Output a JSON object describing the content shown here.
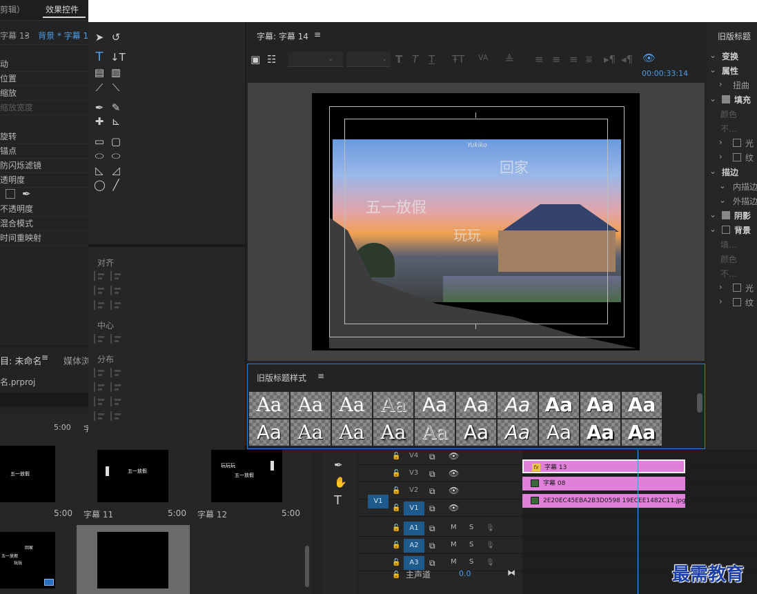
{
  "left_panel": {
    "header_label": "剪辑）",
    "tab_effect_controls": "效果控件",
    "source_label": "字幕 13",
    "clip_label": "背景 * 字幕 1",
    "props": [
      "动",
      "位置",
      "缩放",
      "缩放宽度",
      "",
      "旋转",
      "锚点",
      "防闪烁滤镜",
      "透明度",
      "",
      "不透明度",
      "混合模式",
      "时间重映射"
    ]
  },
  "project_panel": {
    "tab_project": "目: 未命名",
    "tab_media": "媒体浏",
    "file_name": "名.prproj",
    "items": [
      {
        "name": "",
        "duration": "5:00",
        "thumb_text": "五一放假"
      },
      {
        "name": "字幕 11",
        "duration": "5:00",
        "thumb_text": "五一放假"
      },
      {
        "name": "字幕 12",
        "duration": "5:00",
        "thumb_text": "五一放假"
      }
    ],
    "top_durations": [
      "5:00",
      "字"
    ],
    "thumb_texts": [
      "五一放假",
      "回家",
      "玩玩",
      "玩玩玩"
    ]
  },
  "titler": {
    "title": "字幕: 字幕 14",
    "timecode": "00:00:33:14",
    "tools_section_align": "对齐",
    "tools_section_center": "中心",
    "tools_section_distribute": "分布",
    "canvas_texts": {
      "t1": "五一放假",
      "t2": "回家",
      "t3": "玩玩",
      "signature": "Yukiko"
    },
    "styles_panel_title": "旧版标题样式",
    "swatch_label": "Aa",
    "swatch_rows": 2,
    "swatch_cols": 10
  },
  "props_panel": {
    "title": "旧版标题",
    "items": [
      {
        "label": "变换",
        "kind": "section"
      },
      {
        "label": "属性",
        "kind": "section"
      },
      {
        "label": "扭曲",
        "kind": "sub"
      },
      {
        "label": "填充",
        "kind": "check-section"
      },
      {
        "label": "颜色",
        "kind": "dim"
      },
      {
        "label": "不...",
        "kind": "dim"
      },
      {
        "label": "光",
        "kind": "sub-check"
      },
      {
        "label": "纹",
        "kind": "sub-check"
      },
      {
        "label": "描边",
        "kind": "section"
      },
      {
        "label": "内描边",
        "kind": "sub"
      },
      {
        "label": "外描边",
        "kind": "sub"
      },
      {
        "label": "阴影",
        "kind": "check-section"
      },
      {
        "label": "背景",
        "kind": "check-section"
      },
      {
        "label": "填...",
        "kind": "dim"
      },
      {
        "label": "颜色",
        "kind": "dim"
      },
      {
        "label": "不...",
        "kind": "dim"
      },
      {
        "label": "光",
        "kind": "sub-check"
      },
      {
        "label": "纹",
        "kind": "sub-check"
      }
    ]
  },
  "timeline": {
    "tracks": [
      "V4",
      "V3",
      "V2",
      "V1",
      "A1",
      "A2",
      "A3"
    ],
    "source_v1": "V1",
    "master_label": "主声道",
    "master_value": "0.0",
    "clip_colors": {
      "clip": "#e080d8",
      "playhead": "#4a9eea"
    },
    "clips": [
      {
        "track": "V3",
        "label": "字幕 13",
        "icon": "fx"
      },
      {
        "track": "V2",
        "label": "字幕 08",
        "icon": "image"
      },
      {
        "track": "V1",
        "label": "2E20EC45EBA2B3D0598 19ECEE1482C11.jpg",
        "icon": "image"
      }
    ],
    "m_label": "M",
    "s_label": "S"
  },
  "watermark": "最需教育"
}
